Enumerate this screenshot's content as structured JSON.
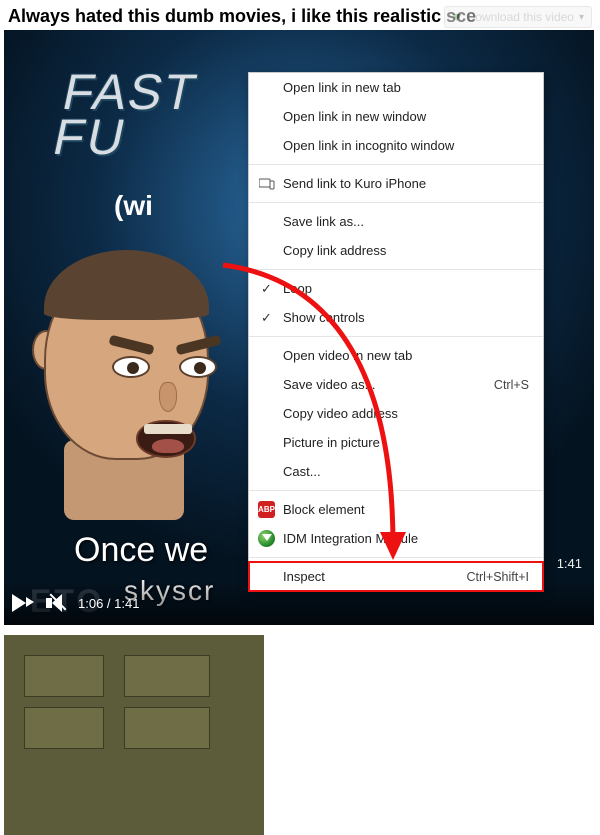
{
  "title": "Always hated this dumb movies, i like this realistic sce",
  "download_button": "Download this video",
  "logo_line1": "FAST",
  "logo_line2": "FU",
  "subtitle_wi": "(wi",
  "caption_line1": "Once we",
  "caption_line2": "skyscr",
  "watermark": "ETO",
  "time": "1:06 / 1:41",
  "duration_hint": "1:41",
  "context_menu": {
    "open_new_tab": "Open link in new tab",
    "open_new_window": "Open link in new window",
    "open_incognito": "Open link in incognito window",
    "send_link": "Send link to Kuro iPhone",
    "save_link": "Save link as...",
    "copy_link": "Copy link address",
    "loop": "Loop",
    "show_controls": "Show controls",
    "open_video_tab": "Open video in new tab",
    "save_video": "Save video as...",
    "save_video_sc": "Ctrl+S",
    "copy_video_addr": "Copy video address",
    "pip": "Picture in picture",
    "cast": "Cast...",
    "abp_label": "ABP",
    "block_element": "Block element",
    "idm": "IDM Integration Module",
    "inspect": "Inspect",
    "inspect_sc": "Ctrl+Shift+I"
  }
}
